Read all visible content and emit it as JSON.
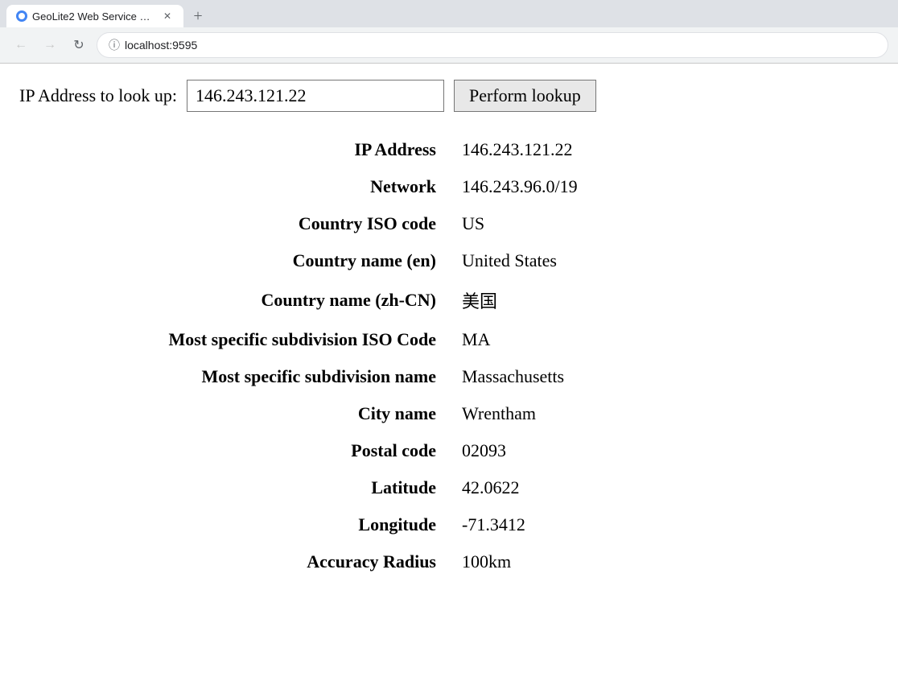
{
  "browser": {
    "tab_label": "GeoLite2 Web Service De…",
    "new_tab_label": "+",
    "address": "localhost:9595"
  },
  "lookup_form": {
    "label": "IP Address to look up:",
    "input_value": "146.243.121.22",
    "button_label": "Perform lookup"
  },
  "results": [
    {
      "field": "IP Address",
      "value": "146.243.121.22"
    },
    {
      "field": "Network",
      "value": "146.243.96.0/19"
    },
    {
      "field": "Country ISO code",
      "value": "US"
    },
    {
      "field": "Country name (en)",
      "value": "United States"
    },
    {
      "field": "Country name (zh-CN)",
      "value": "美国"
    },
    {
      "field": "Most specific subdivision ISO Code",
      "value": "MA"
    },
    {
      "field": "Most specific subdivision name",
      "value": "Massachusetts"
    },
    {
      "field": "City name",
      "value": "Wrentham"
    },
    {
      "field": "Postal code",
      "value": "02093"
    },
    {
      "field": "Latitude",
      "value": "42.0622"
    },
    {
      "field": "Longitude",
      "value": "-71.3412"
    },
    {
      "field": "Accuracy Radius",
      "value": "100km"
    }
  ]
}
